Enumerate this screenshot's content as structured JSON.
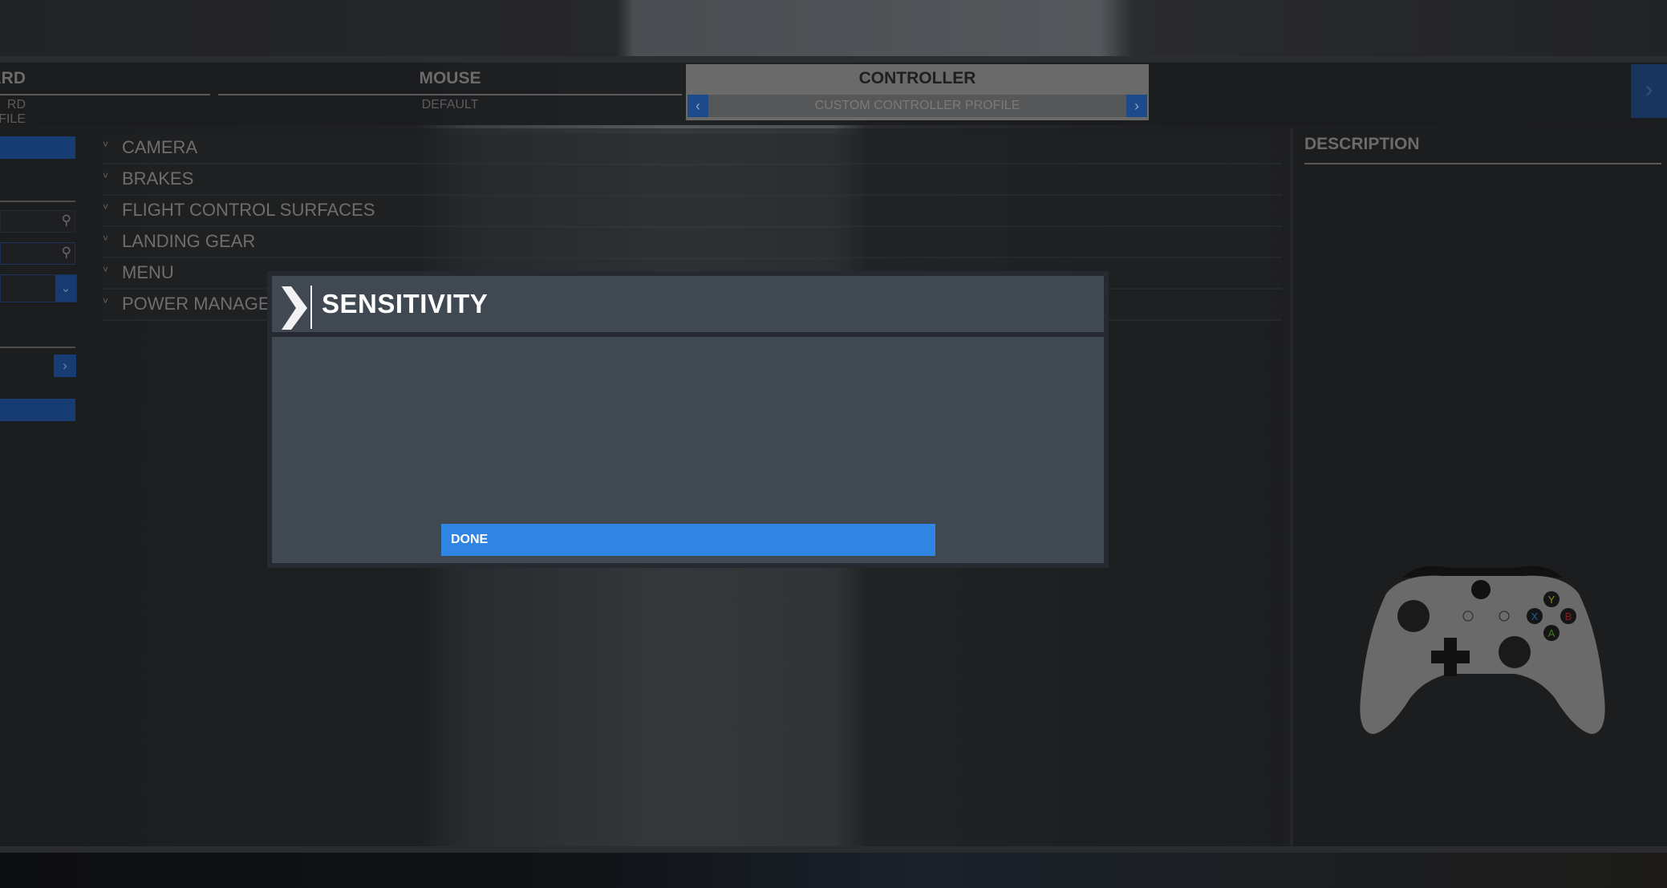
{
  "tabs": [
    {
      "label": "ARD",
      "profile": "RD PROFILE"
    },
    {
      "label": "MOUSE",
      "profile": "DEFAULT"
    },
    {
      "label": "CONTROLLER",
      "profile": "CUSTOM CONTROLLER PROFILE",
      "active": true
    }
  ],
  "tab_icons": {
    "prev": "‹",
    "next": "›",
    "next_tab": "›"
  },
  "left_panel": {
    "search_icon": "⚲",
    "dropdown_icon": "⌄",
    "arrow_icon": "›"
  },
  "categories": [
    {
      "label": "CAMERA"
    },
    {
      "label": "BRAKES"
    },
    {
      "label": "FLIGHT CONTROL SURFACES"
    },
    {
      "label": "LANDING GEAR"
    },
    {
      "label": "MENU"
    },
    {
      "label": "POWER MANAGEMENT"
    }
  ],
  "category_chevron": "˅",
  "description": {
    "title": "DESCRIPTION"
  },
  "modal": {
    "title": "SENSITIVITY",
    "done_label": "DONE"
  },
  "controller": {
    "buttons": {
      "y": "Y",
      "x": "X",
      "b": "B",
      "a": "A"
    }
  },
  "colors": {
    "accent": "#3085e2",
    "modal_bg": "#404852",
    "tab_active": "#6a6a6a"
  }
}
